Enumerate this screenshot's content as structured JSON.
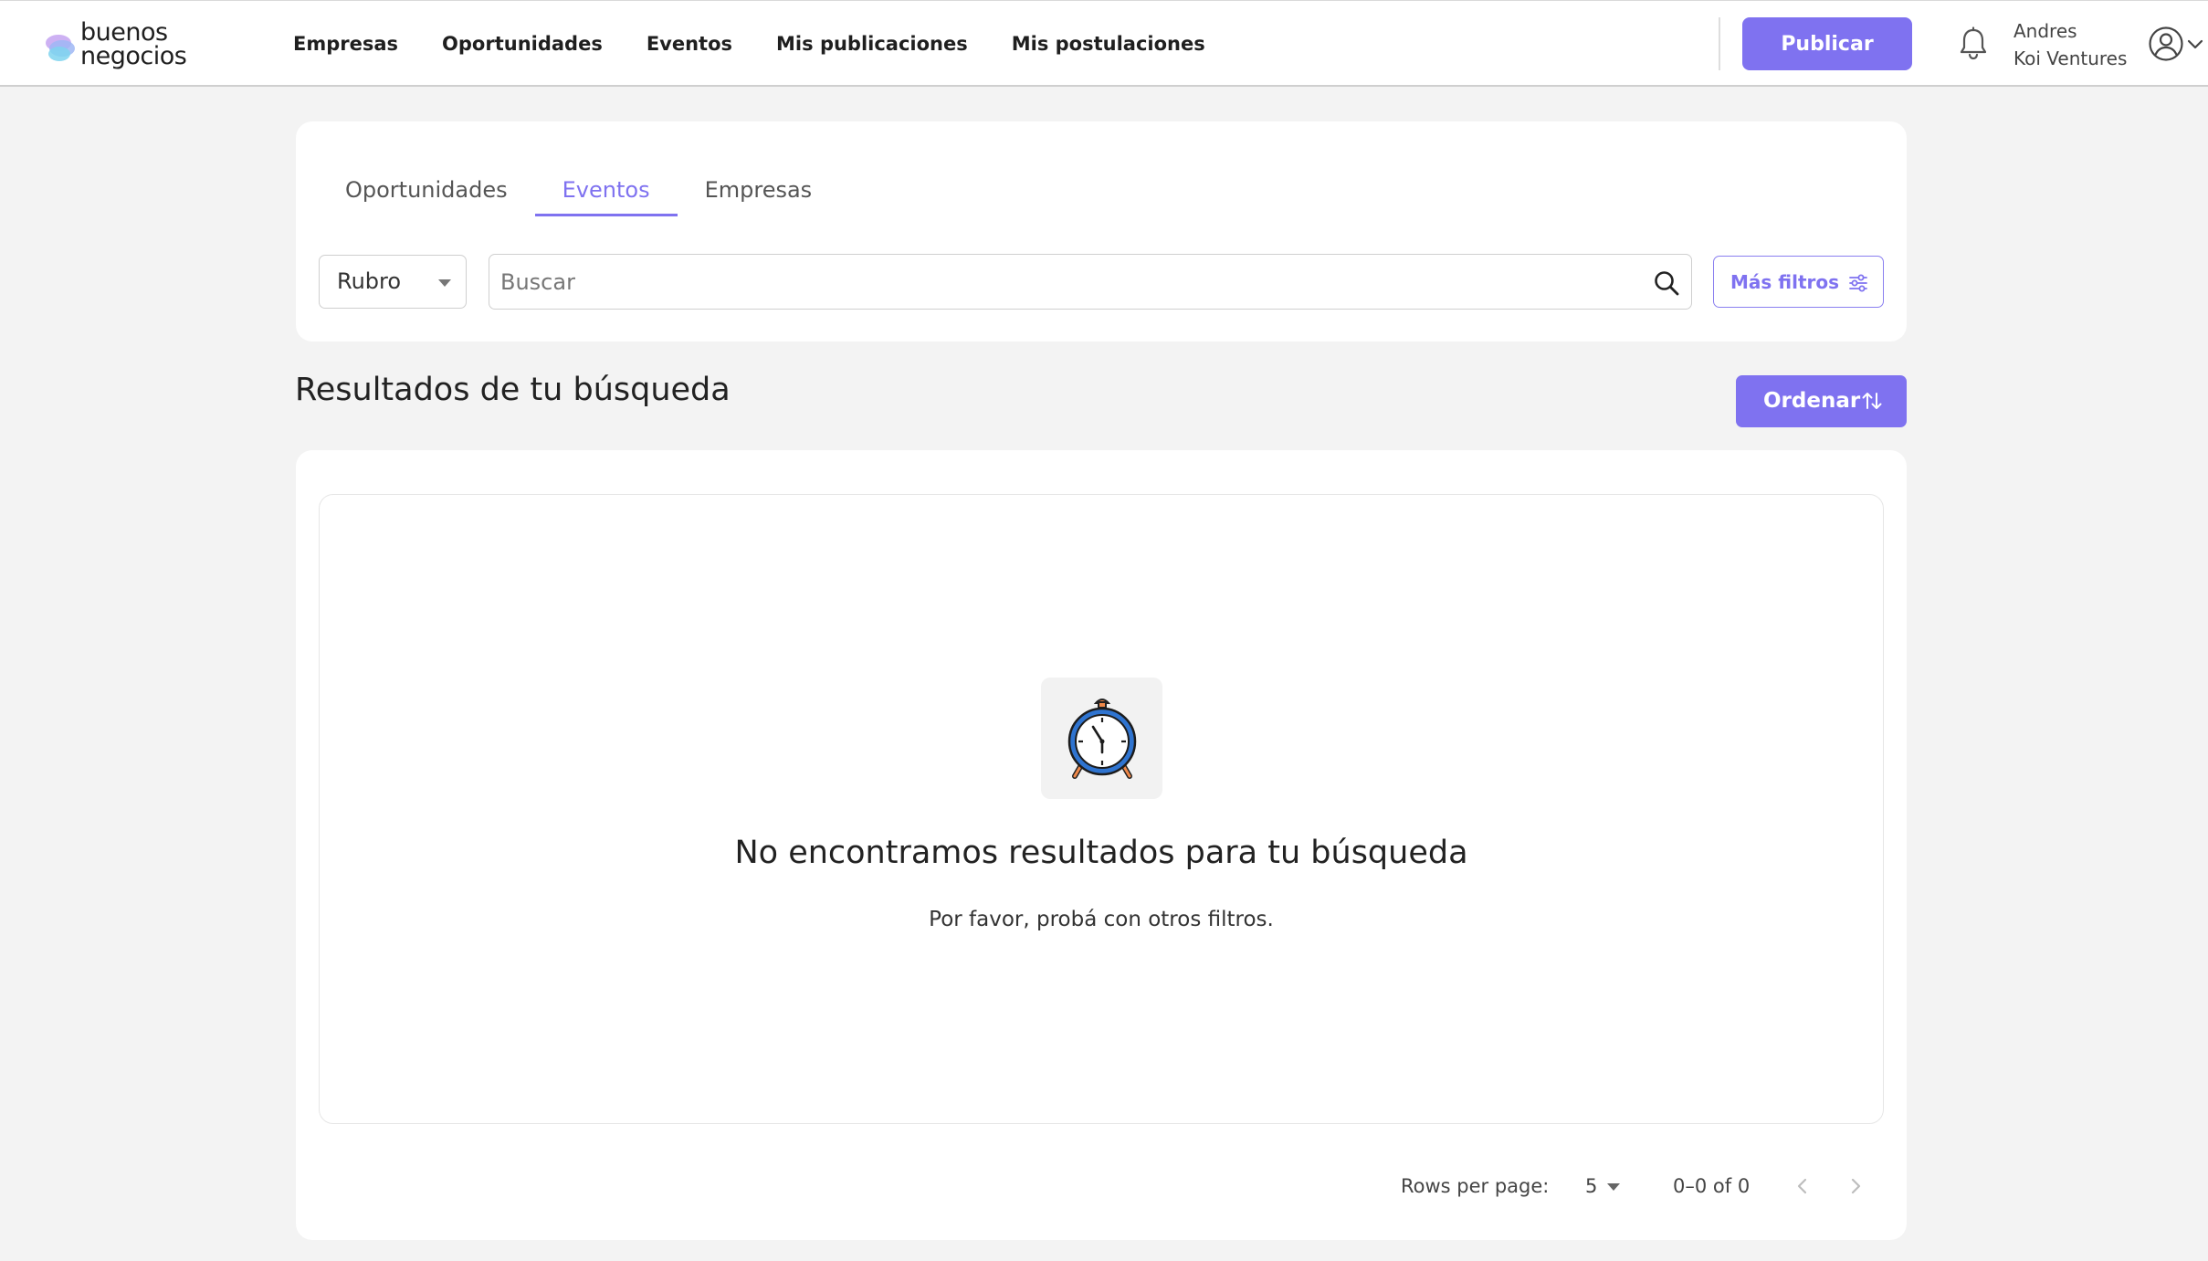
{
  "brand": {
    "line1": "buenos",
    "line2": "negocios",
    "accent": "#7f72f0"
  },
  "nav": {
    "items": [
      {
        "label": "Empresas"
      },
      {
        "label": "Oportunidades"
      },
      {
        "label": "Eventos"
      },
      {
        "label": "Mis publicaciones"
      },
      {
        "label": "Mis postulaciones"
      }
    ],
    "publish_label": "Publicar",
    "notification_icon": "bell-icon",
    "user": {
      "name": "Andres",
      "company": "Koi Ventures",
      "avatar_icon": "user-circle-icon"
    }
  },
  "filters": {
    "tabs": [
      {
        "label": "Oportunidades",
        "active": false
      },
      {
        "label": "Eventos",
        "active": true
      },
      {
        "label": "Empresas",
        "active": false
      }
    ],
    "category_select": {
      "value": "Rubro"
    },
    "search": {
      "placeholder": "Buscar",
      "value": ""
    },
    "more_filters_label": "Más filtros"
  },
  "results": {
    "title": "Resultados de tu búsqueda",
    "order_label": "Ordenar",
    "empty_state": {
      "icon": "alarm-clock-icon",
      "title": "No encontramos resultados para tu búsqueda",
      "subtitle": "Por favor, probá con otros filtros."
    },
    "pagination": {
      "rows_per_page_label": "Rows per page:",
      "rows_per_page_value": "5",
      "range_text": "0–0 of 0"
    }
  }
}
